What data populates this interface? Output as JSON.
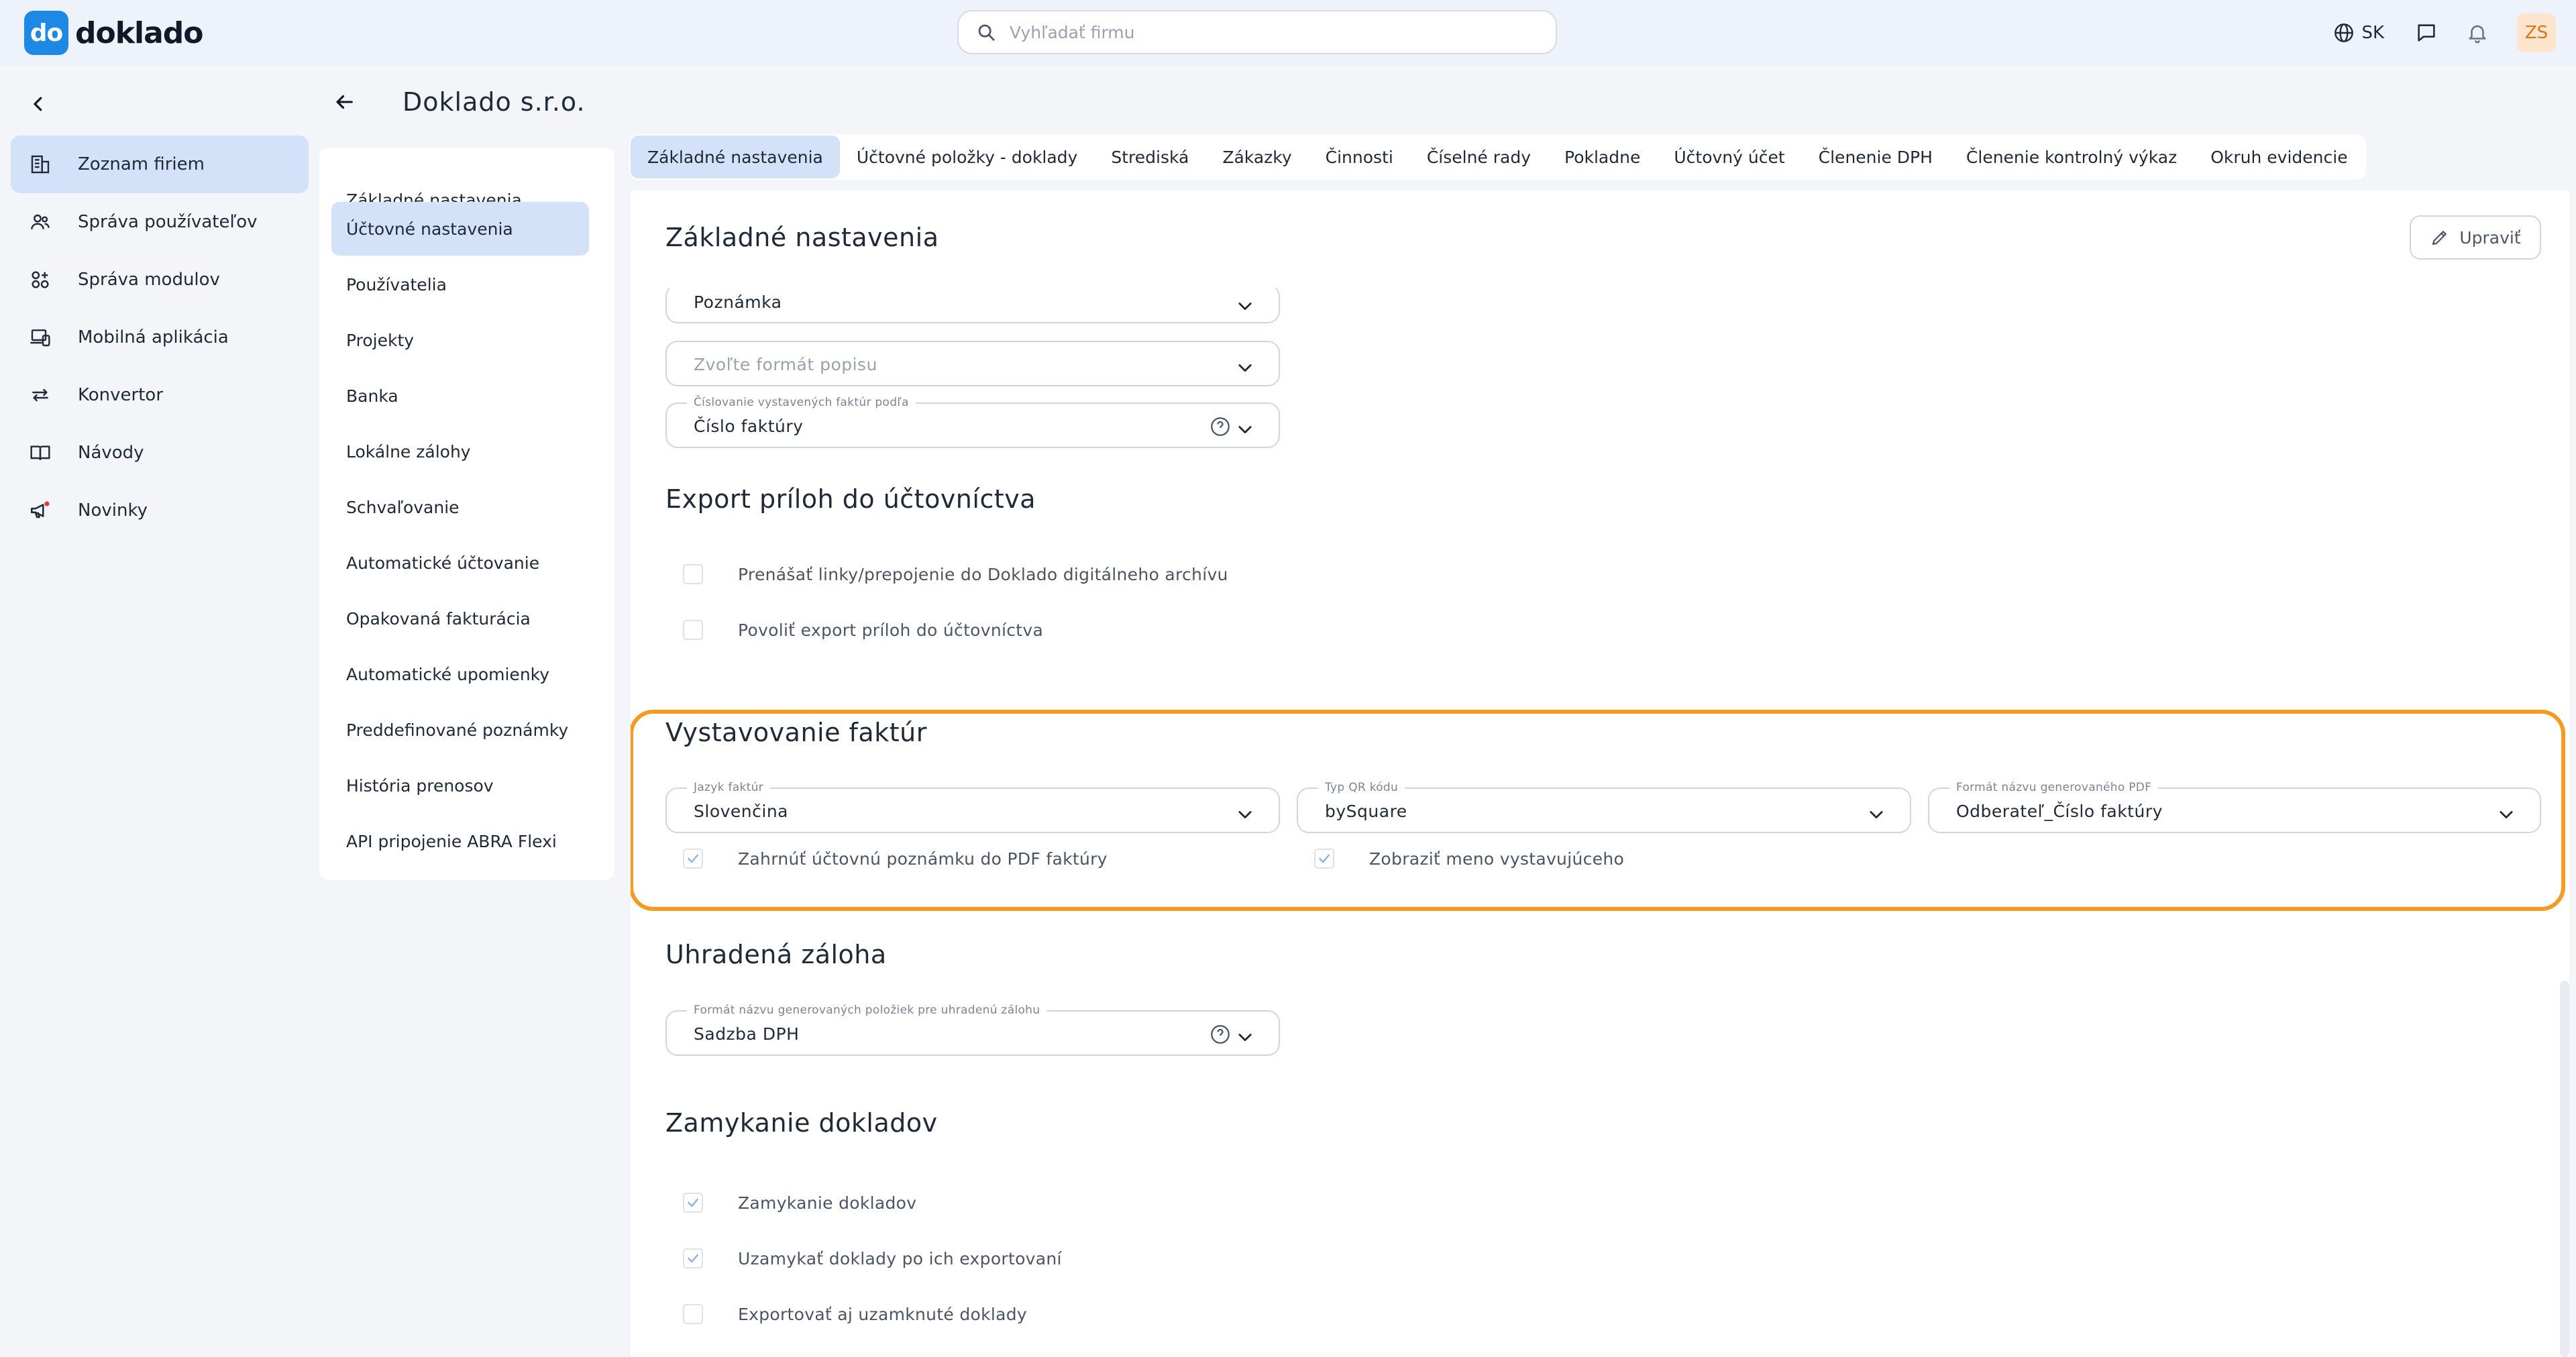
{
  "app": {
    "logo_badge": "do",
    "logo_text": "doklado"
  },
  "search": {
    "placeholder": "Vyhľadať firmu"
  },
  "topbar": {
    "language": "SK",
    "avatar_initials": "ZS"
  },
  "sidebar": {
    "items": [
      {
        "label": "Zoznam firiem",
        "icon": "building-icon",
        "active": true
      },
      {
        "label": "Správa používateľov",
        "icon": "users-icon",
        "active": false
      },
      {
        "label": "Správa modulov",
        "icon": "modules-icon",
        "active": false
      },
      {
        "label": "Mobilná aplikácia",
        "icon": "mobile-app-icon",
        "active": false
      },
      {
        "label": "Konvertor",
        "icon": "convert-arrows-icon",
        "active": false
      },
      {
        "label": "Návody",
        "icon": "book-icon",
        "active": false
      },
      {
        "label": "Novinky",
        "icon": "megaphone-icon",
        "active": false
      }
    ]
  },
  "company": {
    "title": "Doklado s.r.o."
  },
  "subnav": {
    "items": [
      {
        "label": "Základné nastavenia",
        "active": false
      },
      {
        "label": "Účtovné nastavenia",
        "active": true
      },
      {
        "label": "Používatelia",
        "active": false
      },
      {
        "label": "Projekty",
        "active": false
      },
      {
        "label": "Banka",
        "active": false
      },
      {
        "label": "Lokálne zálohy",
        "active": false
      },
      {
        "label": "Schvaľovanie",
        "active": false
      },
      {
        "label": "Automatické účtovanie",
        "active": false
      },
      {
        "label": "Opakovaná fakturácia",
        "active": false
      },
      {
        "label": "Automatické upomienky",
        "active": false
      },
      {
        "label": "Preddefinované poznámky",
        "active": false
      },
      {
        "label": "História prenosov",
        "active": false
      },
      {
        "label": "API pripojenie ABRA Flexi",
        "active": false
      }
    ]
  },
  "tabs": [
    {
      "label": "Základné nastavenia",
      "active": true
    },
    {
      "label": "Účtovné položky - doklady",
      "active": false
    },
    {
      "label": "Strediská",
      "active": false
    },
    {
      "label": "Zákazky",
      "active": false
    },
    {
      "label": "Činnosti",
      "active": false
    },
    {
      "label": "Číselné rady",
      "active": false
    },
    {
      "label": "Pokladne",
      "active": false
    },
    {
      "label": "Účtovný účet",
      "active": false
    },
    {
      "label": "Členenie DPH",
      "active": false
    },
    {
      "label": "Členenie kontrolný výkaz",
      "active": false
    },
    {
      "label": "Okruh evidencie",
      "active": false
    }
  ],
  "main": {
    "title": "Základné nastavenia",
    "edit_label": "Upraviť",
    "basic": {
      "note_value": "Poznámka",
      "description_placeholder": "Zvoľte formát popisu",
      "numbering_label": "Číslovanie vystavených faktúr podľa",
      "numbering_value": "Číslo faktúry"
    },
    "export": {
      "title": "Export príloh do účtovníctva",
      "checks": [
        {
          "label": "Prenášať linky/prepojenie do Doklado digitálneho archívu",
          "checked": false
        },
        {
          "label": "Povoliť export príloh do účtovníctva",
          "checked": false
        }
      ]
    },
    "invoicing": {
      "title": "Vystavovanie faktúr",
      "language_label": "Jazyk faktúr",
      "language_value": "Slovenčina",
      "qr_label": "Typ QR kódu",
      "qr_value": "bySquare",
      "pdf_label": "Formát názvu generovaného PDF",
      "pdf_value": "Odberateľ_Číslo faktúry",
      "checks": [
        {
          "label": "Zahrnúť účtovnú poznámku do PDF faktúry",
          "checked": true
        },
        {
          "label": "Zobraziť meno vystavujúceho",
          "checked": true
        }
      ],
      "highlight_color": "#f59a23"
    },
    "deposit": {
      "title": "Uhradená záloha",
      "format_label": "Formát názvu generovaných položiek pre uhradenú zálohu",
      "format_value": "Sadzba DPH"
    },
    "locking": {
      "title": "Zamykanie dokladov",
      "checks": [
        {
          "label": "Zamykanie dokladov",
          "checked": true
        },
        {
          "label": "Uzamykať doklady po ich exportovaní",
          "checked": true
        },
        {
          "label": "Exportovať aj uzamknuté doklady",
          "checked": false
        }
      ]
    }
  },
  "colors": {
    "accent": "#1e88e5",
    "active_bg": "#d3e2f8",
    "highlight": "#f59a23"
  }
}
